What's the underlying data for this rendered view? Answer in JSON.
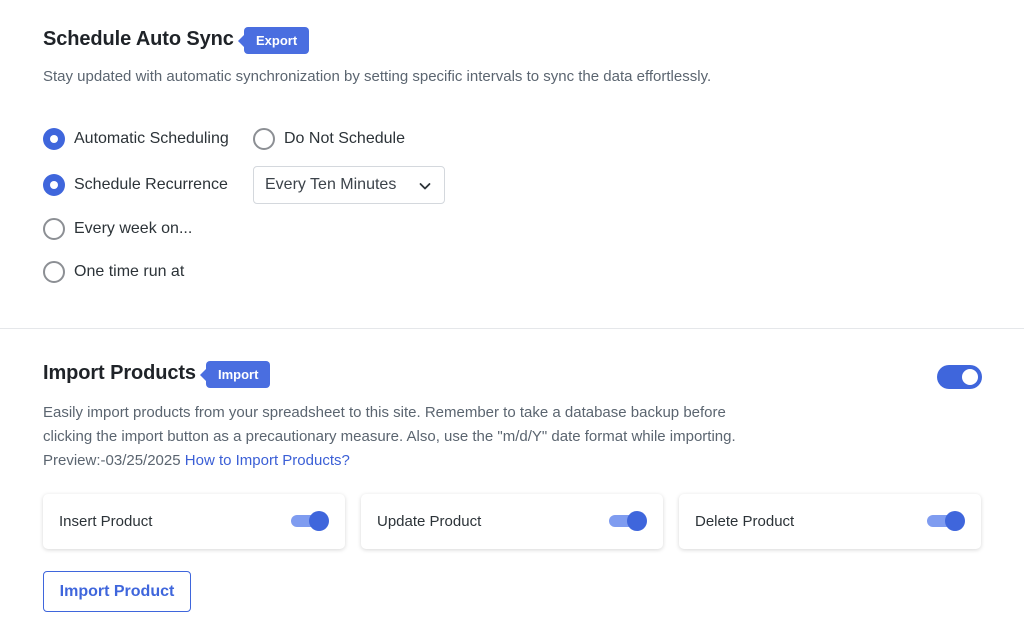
{
  "schedule": {
    "title": "Schedule Auto Sync",
    "tag": "Export",
    "description": "Stay updated with automatic synchronization by setting specific intervals to sync the data effortlessly.",
    "options": {
      "automatic": {
        "label": "Automatic Scheduling",
        "checked": true
      },
      "do_not": {
        "label": "Do Not Schedule",
        "checked": false
      },
      "recurrence": {
        "label": "Schedule Recurrence",
        "checked": true
      },
      "weekly": {
        "label": "Every week on...",
        "checked": false
      },
      "one_time": {
        "label": "One time run at",
        "checked": false
      }
    },
    "recurrence_select": {
      "value": "Every Ten Minutes",
      "icon": "chevron-down-icon"
    }
  },
  "import": {
    "title": "Import Products",
    "tag": "Import",
    "enabled": true,
    "description_line1": "Easily import products from your spreadsheet to this site. Remember to take a database backup before",
    "description_line2": "clicking the import button as a precautionary measure. Also, use the \"m/d/Y\" date format while importing.",
    "preview_label": "Preview:-03/25/2025",
    "help_link": "How to Import Products?",
    "cards": [
      {
        "label": "Insert Product",
        "enabled": true
      },
      {
        "label": "Update Product",
        "enabled": true
      },
      {
        "label": "Delete Product",
        "enabled": true
      }
    ],
    "button_label": "Import Product"
  },
  "colors": {
    "accent": "#3f66dc",
    "tag": "#4a6ee0",
    "link": "#3b5fd6"
  }
}
